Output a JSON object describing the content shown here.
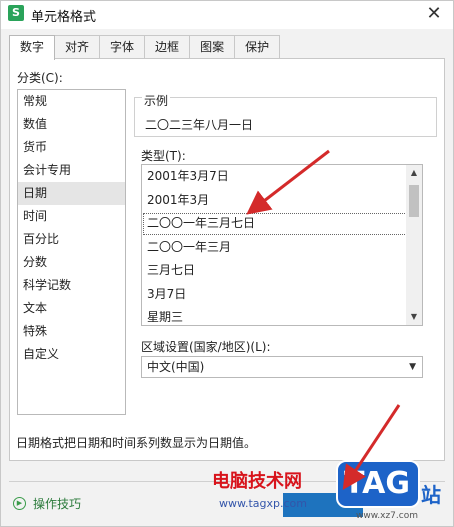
{
  "window": {
    "title": "单元格格式",
    "app_icon_letter": "S",
    "close_glyph": "✕"
  },
  "tabs": [
    {
      "label": "数字",
      "active": true
    },
    {
      "label": "对齐"
    },
    {
      "label": "字体"
    },
    {
      "label": "边框"
    },
    {
      "label": "图案"
    },
    {
      "label": "保护"
    }
  ],
  "category": {
    "label": "分类(C):",
    "items": [
      "常规",
      "数值",
      "货币",
      "会计专用",
      "日期",
      "时间",
      "百分比",
      "分数",
      "科学记数",
      "文本",
      "特殊",
      "自定义"
    ],
    "selected": "日期"
  },
  "sample": {
    "label": "示例",
    "value": "二〇二三年八月一日"
  },
  "type": {
    "label": "类型(T):",
    "items": [
      "2001年3月7日",
      "2001年3月",
      "二〇〇一年三月七日",
      "二〇〇一年三月",
      "三月七日",
      "3月7日",
      "星期三"
    ],
    "selected": "二〇〇一年三月七日"
  },
  "region": {
    "label": "区域设置(国家/地区)(L):",
    "value": "中文(中国)"
  },
  "description": "日期格式把日期和时间系列数显示为日期值。",
  "footer": {
    "tips_label": "操作技巧"
  },
  "watermark": {
    "site_name": "电脑技术网",
    "url": "www.tagxp.com",
    "tag": "TAG",
    "zhan": "站",
    "url2": "www.xz7.com"
  },
  "colors": {
    "accent": "#1e73be",
    "arrow": "#d42a2a",
    "brand_green": "#2aa35a"
  }
}
